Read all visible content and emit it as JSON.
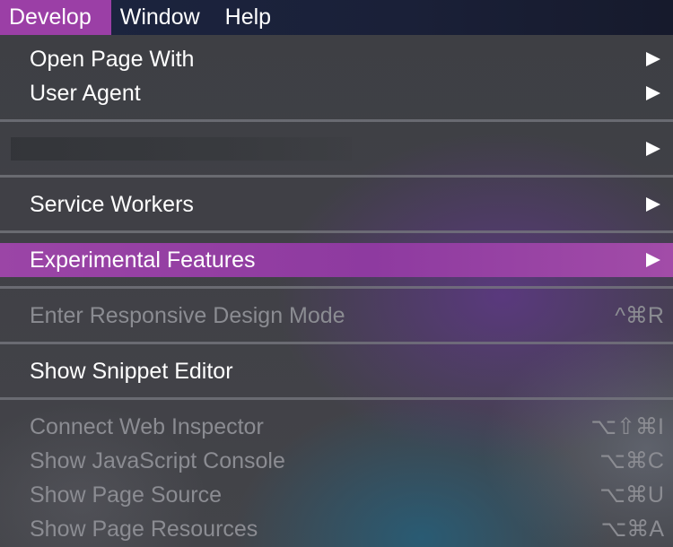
{
  "menubar": {
    "items": [
      {
        "label": "Develop",
        "active": true
      },
      {
        "label": "Window",
        "active": false
      },
      {
        "label": "Help",
        "active": false
      }
    ]
  },
  "menu": {
    "highlight_color": "#9b45a6",
    "items": [
      {
        "label": "Open Page With",
        "submenu": true,
        "enabled": true
      },
      {
        "label": "User Agent",
        "submenu": true,
        "enabled": true
      },
      {
        "label": "",
        "submenu": true,
        "enabled": true,
        "redacted": true
      },
      {
        "label": "Service Workers",
        "submenu": true,
        "enabled": true
      },
      {
        "label": "Experimental Features",
        "submenu": true,
        "enabled": true,
        "highlighted": true
      },
      {
        "label": "Enter Responsive Design Mode",
        "shortcut": "^⌘R",
        "enabled": false
      },
      {
        "label": "Show Snippet Editor",
        "enabled": true
      },
      {
        "label": "Connect Web Inspector",
        "shortcut": "⌥⇧⌘I",
        "enabled": false
      },
      {
        "label": "Show JavaScript Console",
        "shortcut": "⌥⌘C",
        "enabled": false
      },
      {
        "label": "Show Page Source",
        "shortcut": "⌥⌘U",
        "enabled": false
      },
      {
        "label": "Show Page Resources",
        "shortcut": "⌥⌘A",
        "enabled": false
      }
    ]
  }
}
